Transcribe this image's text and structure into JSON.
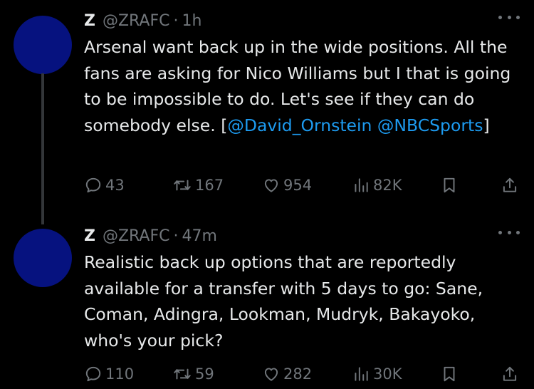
{
  "tweets": [
    {
      "name": "Z",
      "handle": "@ZRAFC",
      "separator": "·",
      "time": "1h",
      "text_before": "Arsenal want back up in the wide positions. All the fans are asking for Nico Williams but I that is going to be impossible to do. Let's see if they can do somebody else. [",
      "mention1": "@David_Ornstein",
      "mention2": "@NBCSports",
      "text_after": "]",
      "replies": "43",
      "reposts": "167",
      "likes": "954",
      "views": "82K"
    },
    {
      "name": "Z",
      "handle": "@ZRAFC",
      "separator": "·",
      "time": "47m",
      "text": "Realistic back up options that are reportedly available for a transfer with 5 days to go: Sane, Coman, Adingra, Lookman, Mudryk, Bakayoko, who's your pick?",
      "replies": "110",
      "reposts": "59",
      "likes": "282",
      "views": "30K"
    }
  ],
  "colors": {
    "background": "#000000",
    "avatar": "#06127f",
    "text": "#e7e9ea",
    "muted": "#71767b",
    "link": "#1d9bf0",
    "thread_line": "#333639"
  },
  "icons": [
    "reply-icon",
    "repost-icon",
    "like-icon",
    "views-icon",
    "bookmark-icon",
    "share-icon",
    "more-icon"
  ]
}
